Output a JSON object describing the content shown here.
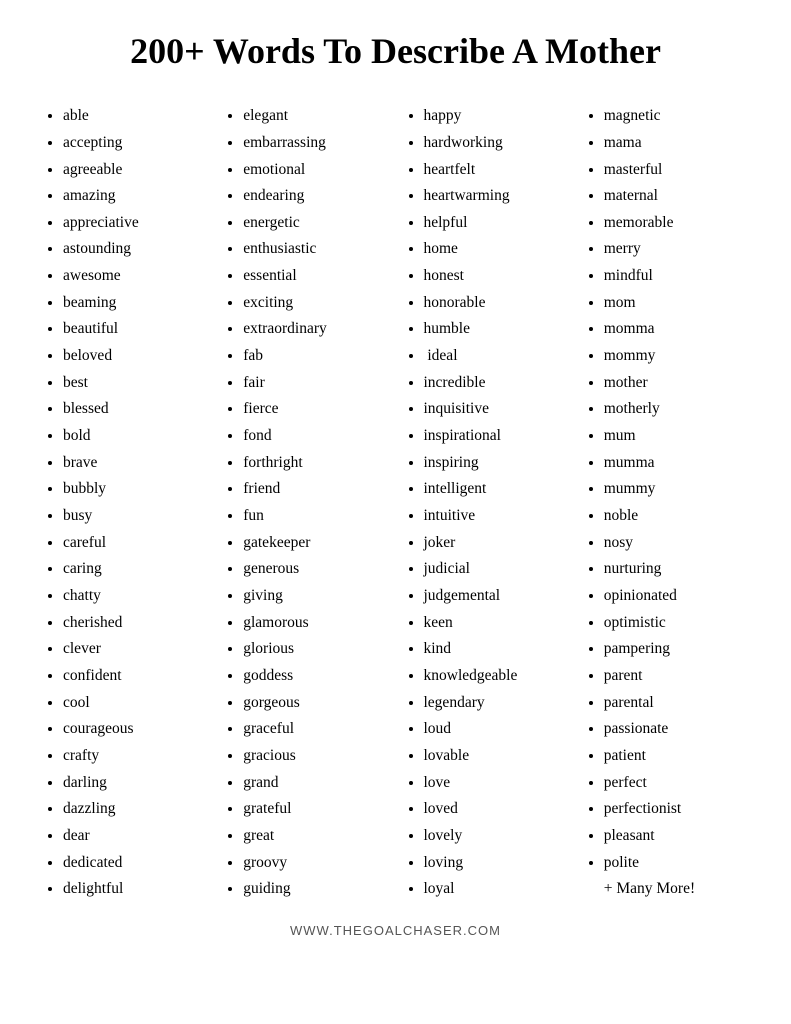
{
  "title": "200+ Words To Describe A Mother",
  "columns": [
    {
      "id": "col1",
      "words": [
        "able",
        "accepting",
        "agreeable",
        "amazing",
        "appreciative",
        "astounding",
        "awesome",
        "beaming",
        "beautiful",
        "beloved",
        "best",
        "blessed",
        "bold",
        "brave",
        "bubbly",
        "busy",
        "careful",
        "caring",
        "chatty",
        "cherished",
        "clever",
        "confident",
        "cool",
        "courageous",
        "crafty",
        "darling",
        "dazzling",
        "dear",
        "dedicated",
        "delightful"
      ]
    },
    {
      "id": "col2",
      "words": [
        "elegant",
        "embarrassing",
        "emotional",
        "endearing",
        "energetic",
        "enthusiastic",
        "essential",
        "exciting",
        "extraordinary",
        "fab",
        "fair",
        "fierce",
        "fond",
        "forthright",
        "friend",
        "fun",
        "gatekeeper",
        "generous",
        "giving",
        "glamorous",
        "glorious",
        "goddess",
        "gorgeous",
        "graceful",
        "gracious",
        "grand",
        "grateful",
        "great",
        "groovy",
        "guiding"
      ]
    },
    {
      "id": "col3",
      "words": [
        "happy",
        "hardworking",
        "heartfelt",
        "heartwarming",
        "helpful",
        "home",
        "honest",
        "honorable",
        "humble",
        " ideal",
        "incredible",
        "inquisitive",
        "inspirational",
        "inspiring",
        "intelligent",
        "intuitive",
        "joker",
        "judicial",
        "judgemental",
        "keen",
        "kind",
        "knowledgeable",
        "legendary",
        "loud",
        "lovable",
        "love",
        "loved",
        "lovely",
        "loving",
        "loyal"
      ]
    },
    {
      "id": "col4",
      "words": [
        "magnetic",
        "mama",
        "masterful",
        "maternal",
        "memorable",
        "merry",
        "mindful",
        "mom",
        "momma",
        "mommy",
        "mother",
        "motherly",
        "mum",
        "mumma",
        "mummy",
        "noble",
        "nosy",
        "nurturing",
        "opinionated",
        "optimistic",
        "pampering",
        "parent",
        "parental",
        "passionate",
        "patient",
        "perfect",
        "perfectionist",
        "pleasant",
        "polite"
      ],
      "extra": "+ Many More!"
    }
  ],
  "footer": "WWW.THEGOALCHASER.COM"
}
